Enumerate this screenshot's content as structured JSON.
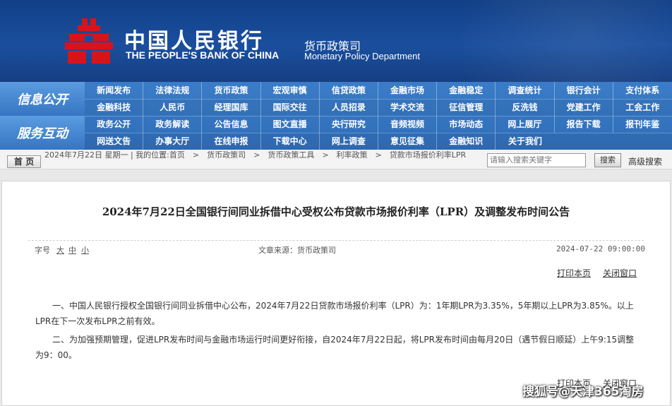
{
  "header": {
    "bank_cn": "中国人民银行",
    "bank_en": "THE PEOPLE'S BANK OF CHINA",
    "dept_cn": "货币政策司",
    "dept_en": "Monetary Policy Department",
    "logo_icon": "pboc-logo-icon",
    "accent_color": "#c8161d",
    "header_color": "#1a4f9e"
  },
  "nav": {
    "section1": "信息公开",
    "section2": "服务互动",
    "rows": [
      [
        "新闻发布",
        "法律法规",
        "货币政策",
        "宏观审慎",
        "信贷政策",
        "金融市场",
        "金融稳定",
        "调查统计",
        "银行会计",
        "支付体系"
      ],
      [
        "金融科技",
        "人民币",
        "经理国库",
        "国际交往",
        "人员招录",
        "学术交流",
        "征信管理",
        "反洗钱",
        "党建工作",
        "工会工作"
      ],
      [
        "政务公开",
        "政务解读",
        "公告信息",
        "图文直播",
        "央行研究",
        "音频视频",
        "市场动态",
        "网上展厅",
        "报告下载",
        "报刊年鉴"
      ],
      [
        "网送文告",
        "办事大厅",
        "在线申报",
        "下载中心",
        "网上调查",
        "意见征集",
        "金融知识",
        "关于我们"
      ]
    ]
  },
  "crumbbar": {
    "home_label": "首 页",
    "crumb_text": "2024年7月22日 星期一 | 我的位置:首页　>　货币政策司　>　货币政策工具　>　利率政策　>　贷款市场报价利率LPR",
    "search_placeholder": "请输入搜索关键字",
    "search_button": "搜索",
    "advanced_search": "高级搜索"
  },
  "article": {
    "title": "2024年7月22日全国银行间同业拆借中心受权公布贷款市场报价利率（LPR）及调整发布时间公告",
    "fontsize_label": "字号",
    "fontsize_large": "大",
    "fontsize_medium": "中",
    "fontsize_small": "小",
    "source": "文章来源：货币政策司",
    "date": "2024-07-22 09:00:00",
    "print_label": "打印本页",
    "close_label": "关闭窗口",
    "paragraphs": [
      "一、中国人民银行授权全国银行间同业拆借中心公布，2024年7月22日贷款市场报价利率（LPR）为：1年期LPR为3.35%，5年期以上LPR为3.85%。以上LPR在下一次发布LPR之前有效。",
      "二、为加强预期管理，促进LPR发布时间与金融市场运行时间更好衔接，自2024年7月22日起，将LPR发布时间由每月20日（遇节假日顺延）上午9:15调整为9：00。"
    ]
  },
  "watermark": "搜狐号@天津365淘房"
}
